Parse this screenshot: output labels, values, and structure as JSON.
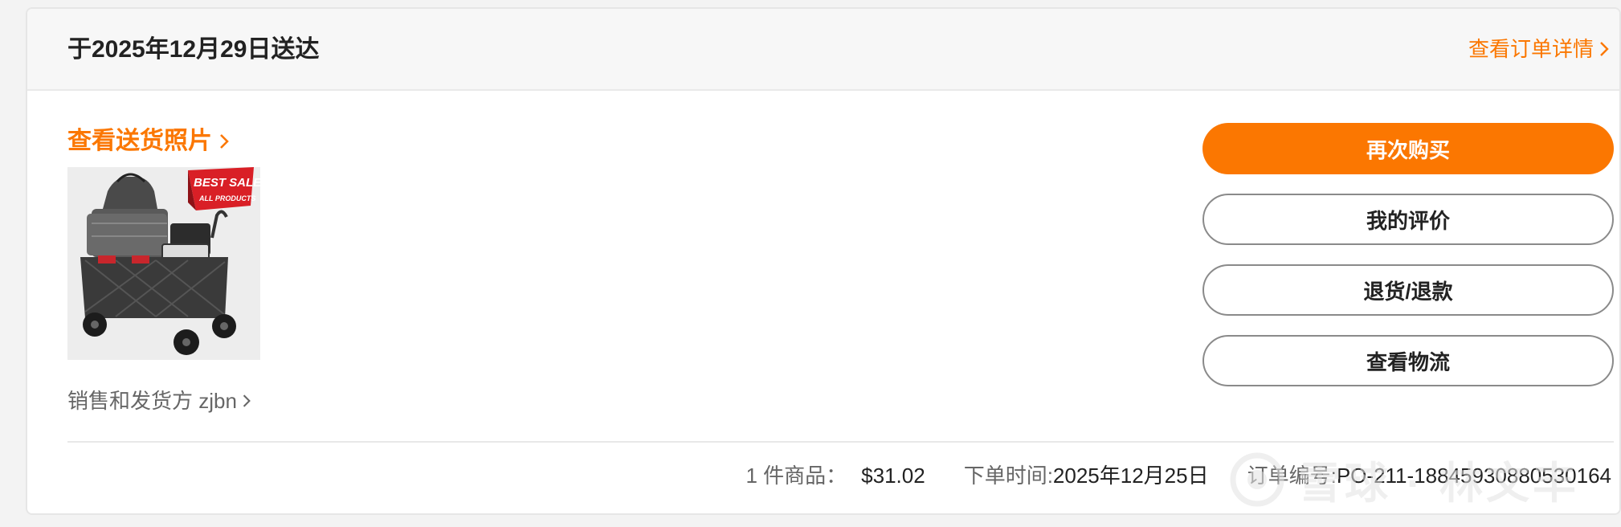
{
  "header": {
    "delivery_title": "于2025年12月29日送达",
    "order_detail_link": "查看订单详情"
  },
  "delivery_photo_link": "查看送货照片",
  "product": {
    "badge_title": "BEST SALE",
    "badge_subtitle": "ALL PRODUCTS"
  },
  "seller_text": "销售和发货方 zjbn",
  "actions": {
    "buy_again": "再次购买",
    "my_review": "我的评价",
    "return_refund": "退货/退款",
    "view_logistics": "查看物流"
  },
  "footer": {
    "items_label": "1 件商品：",
    "items_total": "$31.02",
    "order_time_label": "下单时间: ",
    "order_time": "2025年12月25日",
    "order_no_label": "订单编号: ",
    "order_no": "PO-211-18845930880530164"
  },
  "watermark": "雪球 · 林文丰",
  "colors": {
    "accent": "#fb7701",
    "text": "#222222",
    "muted": "#666666"
  }
}
